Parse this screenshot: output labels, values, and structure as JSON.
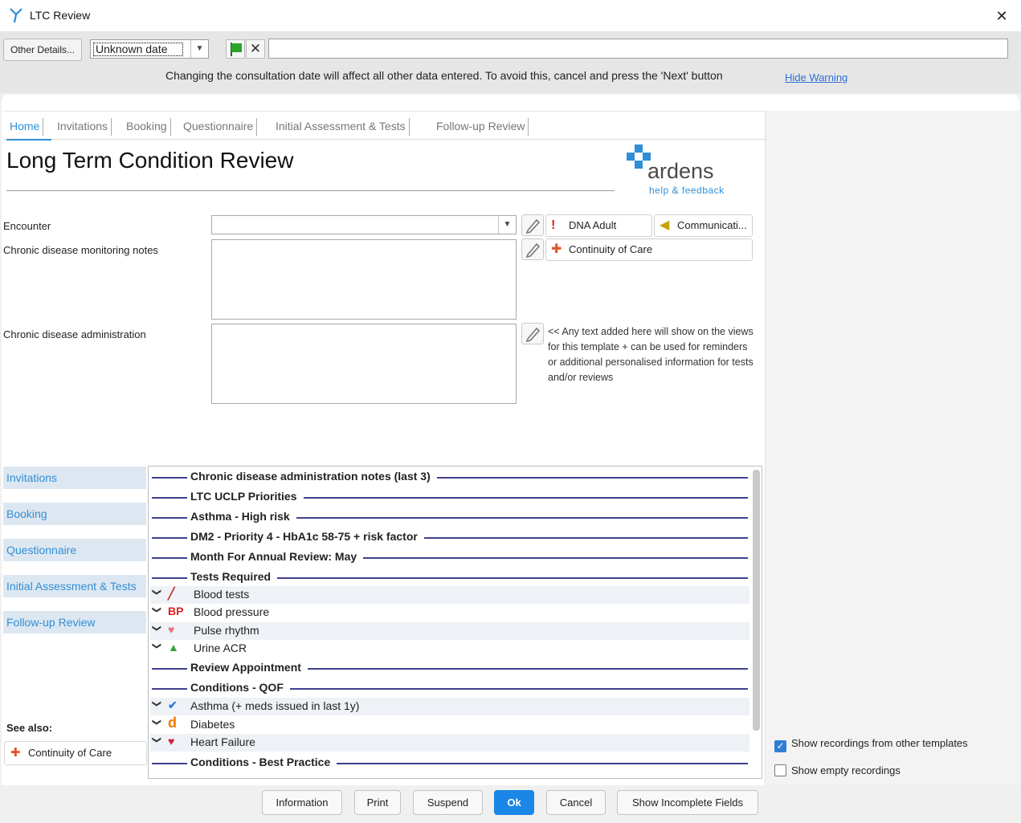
{
  "window": {
    "title": "LTC Review",
    "close": "✕"
  },
  "toolbar": {
    "other_details": "Other Details...",
    "date_value": "Unknown date",
    "date_arrow": "▼",
    "clear": "✕",
    "warning": "Changing the consultation date will affect all other data entered. To avoid this, cancel and press the 'Next' button",
    "hide_warning": "Hide Warning"
  },
  "tabs": [
    "Home",
    "Invitations",
    "Booking",
    "Questionnaire",
    "Initial Assessment & Tests",
    "Follow-up Review"
  ],
  "page": {
    "title": "Long Term Condition Review"
  },
  "logo": {
    "word": "ardens",
    "help": "help & feedback"
  },
  "form": {
    "encounter_label": "Encounter",
    "encounter_arrow": "▼",
    "monitoring_label": "Chronic disease monitoring notes",
    "admin_label": "Chronic disease administration",
    "note": "<< Any text added here will show on the views for this template + can be used for reminders or additional personalised information for tests and/or reviews"
  },
  "side_buttons": {
    "dna_adult": "DNA Adult",
    "communication": "Communicati...",
    "continuity": "Continuity of Care"
  },
  "leftnav": [
    "Invitations",
    "Booking",
    "Questionnaire",
    "Initial Assessment & Tests",
    "Follow-up Review"
  ],
  "see_also": {
    "label": "See also:",
    "item": "Continuity of Care"
  },
  "list": {
    "sections": [
      "Chronic disease administration notes (last 3)",
      "LTC UCLP Priorities",
      "Asthma - High risk",
      "DM2 - Priority 4 - HbA1c 58-75 + risk factor",
      "Month For Annual Review: May",
      "Tests Required",
      "Review Appointment",
      "Conditions - QOF",
      "Conditions - Best Practice"
    ],
    "tests": [
      {
        "label": "Blood tests",
        "icon": "syringe-icon"
      },
      {
        "label": "Blood pressure",
        "icon": "bp-icon",
        "icon_text": "BP"
      },
      {
        "label": "Pulse rhythm",
        "icon": "heart-pulse-icon"
      },
      {
        "label": "Urine ACR",
        "icon": "flask-icon"
      }
    ],
    "conditions": [
      {
        "label": "Asthma (+ meds issued in last 1y)",
        "icon": "checkmark-icon"
      },
      {
        "label": "Diabetes",
        "icon": "diabetes-d-icon",
        "icon_text": "d"
      },
      {
        "label": "Heart Failure",
        "icon": "heart-failure-icon"
      }
    ]
  },
  "options": {
    "show_other": "Show recordings from other templates",
    "show_other_checked": true,
    "show_empty": "Show empty recordings",
    "show_empty_checked": false
  },
  "buttons": {
    "information": "Information",
    "print": "Print",
    "suspend": "Suspend",
    "ok": "Ok",
    "cancel": "Cancel",
    "show_incomplete": "Show Incomplete Fields"
  },
  "colors": {
    "accent": "#2f8fd6",
    "primary_button": "#1a86e6",
    "section_rule": "#3f3f8f"
  }
}
